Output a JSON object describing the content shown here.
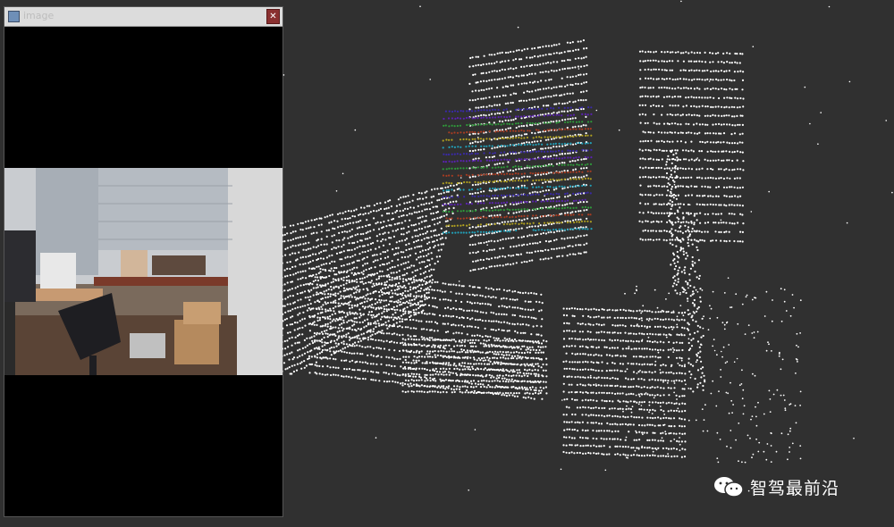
{
  "image_window": {
    "title": "image",
    "close_glyph": "✕",
    "icon": "app-window-icon"
  },
  "watermark": {
    "text": "智驾最前沿",
    "icon": "wechat-logo"
  },
  "colors": {
    "background": "#303030",
    "point_white": "#ffffff",
    "highlight_colors": [
      "#3a2aa8",
      "#5a22b0",
      "#2f9a3a",
      "#a83c22",
      "#b0a020",
      "#22a0b8"
    ]
  }
}
